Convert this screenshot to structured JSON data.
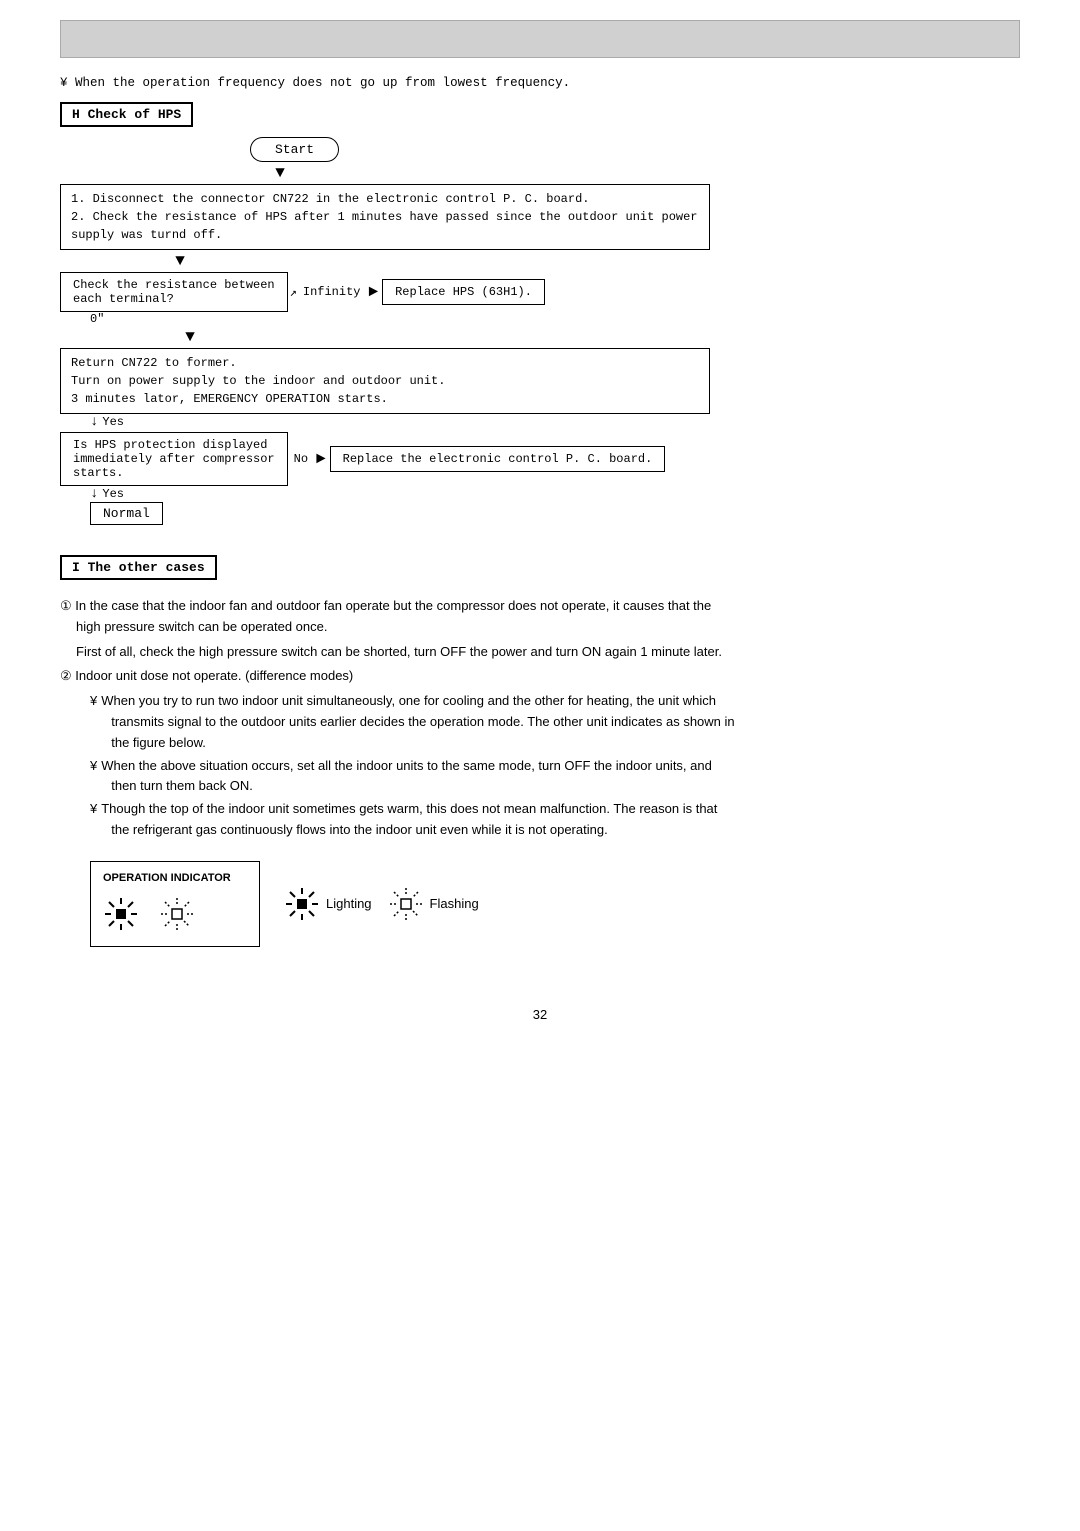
{
  "header": {
    "bar_label": ""
  },
  "frequency_note": "¥ When the operation frequency does not go up from lowest frequency.",
  "section_h": {
    "label": "H  Check of HPS",
    "start_label": "Start",
    "step1": "1. Disconnect the connector CN722 in the electronic control P. C. board.",
    "step2": "2. Check the resistance of HPS after 1 minutes have passed since the outdoor unit power supply was turnd off.",
    "check_resistance": "Check the resistance between\neach terminal?",
    "infinity_label": "Infinity",
    "replace_hps": "Replace HPS (63H1).",
    "zero_label": "0\"",
    "return_cn722": "Return CN722 to former.\nTurn on power supply to the indoor and outdoor unit.\n3 minutes lator, EMERGENCY OPERATION starts.",
    "yes_label": "Yes",
    "hps_question": "Is HPS protection displayed\nimmediately after compressor\nstarts.",
    "no_label": "No",
    "replace_board": "Replace the electronic control P. C. board.",
    "yes_label2": "Yes",
    "normal_label": "Normal"
  },
  "section_i": {
    "label": "I  The other cases",
    "para1": "① In the case that the indoor fan and outdoor fan operate but the compressor does not operate, it causes that the\n   high pressure switch can be operated once.",
    "para1b": "   First of all, check the high pressure switch can be shorted, turn OFF the power and turn ON again 1 minute later.",
    "para2": "② Indoor unit dose not operate. (difference modes)",
    "bullet1": "¥ When you try to run two indoor unit simultaneously, one for cooling and the other for heating, the unit which\n   transmits signal to the outdoor units earlier decides the operation mode. The other unit indicates as shown in\n   the figure below.",
    "bullet2": "¥ When the above situation occurs, set all the indoor units to the same mode, turn OFF the indoor units, and\n   then turn them back ON.",
    "bullet3": "¥ Though the top of the indoor unit sometimes gets warm, this does not mean malfunction. The reason is that\n   the refrigerant gas continuously flows into the indoor unit even while it is not operating.",
    "op_indicator_title": "OPERATION INDICATOR",
    "lighting_label": "Lighting",
    "flashing_label": "Flashing"
  },
  "page_number": "32"
}
